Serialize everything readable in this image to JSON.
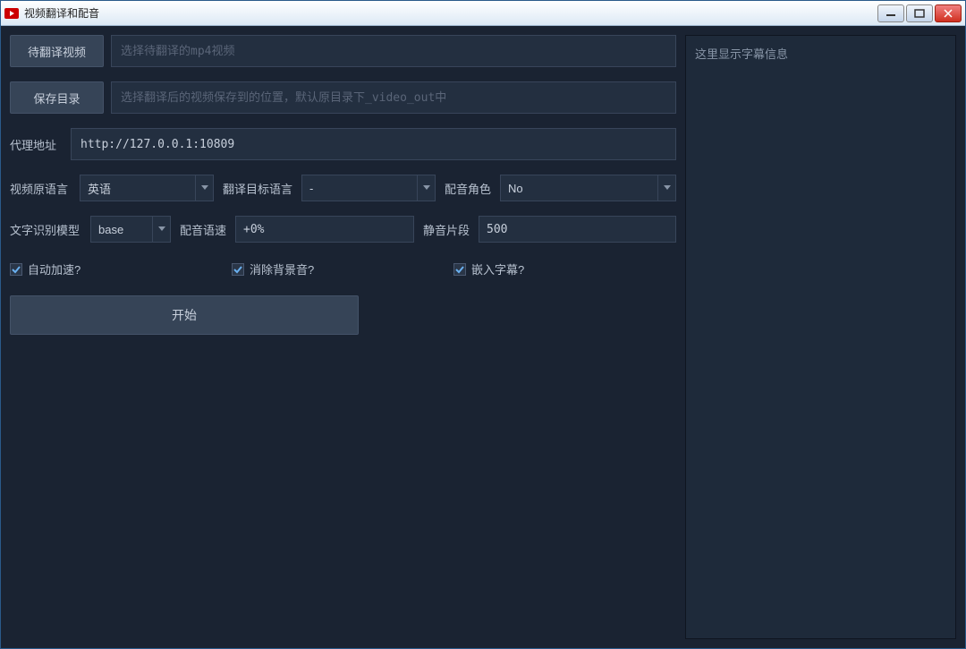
{
  "window": {
    "title": "视频翻译和配音"
  },
  "buttons": {
    "selectVideo": "待翻译视频",
    "saveDir": "保存目录",
    "start": "开始"
  },
  "placeholders": {
    "videoPath": "选择待翻译的mp4视频",
    "savePath": "选择翻译后的视频保存到的位置，默认原目录下_video_out中"
  },
  "labels": {
    "proxy": "代理地址",
    "sourceLang": "视频原语言",
    "targetLang": "翻译目标语言",
    "voiceRole": "配音角色",
    "model": "文字识别模型",
    "voiceRate": "配音语速",
    "silence": "静音片段",
    "autoSpeed": "自动加速?",
    "removeBg": "消除背景音?",
    "embedSub": "嵌入字幕?"
  },
  "values": {
    "proxy": "http://127.0.0.1:10809",
    "sourceLang": "英语",
    "targetLang": "-",
    "voiceRole": "No",
    "model": "base",
    "voiceRate": "+0%",
    "silence": "500"
  },
  "sidebar": {
    "placeholder": "这里显示字幕信息"
  }
}
